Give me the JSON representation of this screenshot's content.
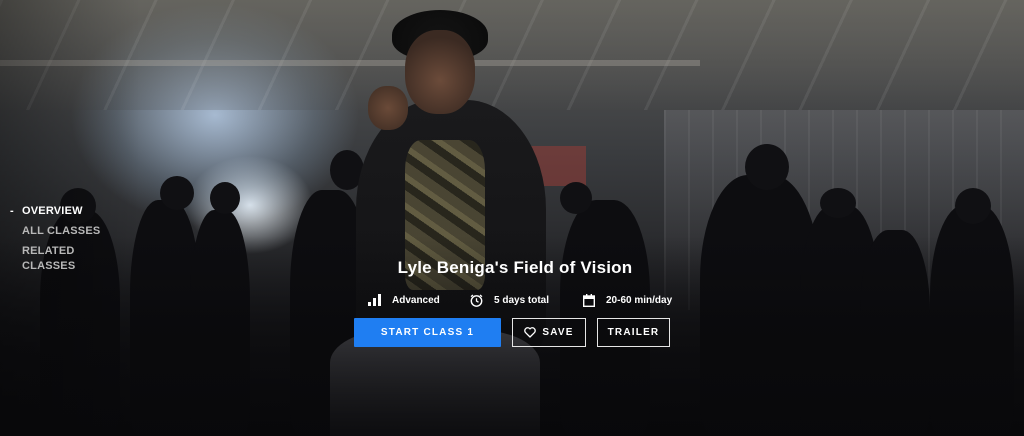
{
  "sidebar": {
    "items": [
      {
        "label": "OVERVIEW",
        "active": true
      },
      {
        "label": "ALL CLASSES",
        "active": false
      },
      {
        "label": "RELATED CLASSES",
        "active": false
      }
    ]
  },
  "hero": {
    "title": "Lyle Beniga's Field of Vision",
    "meta": {
      "level": {
        "icon": "signal-bars-icon",
        "text": "Advanced"
      },
      "duration": {
        "icon": "clock-icon",
        "text": "5 days total"
      },
      "schedule": {
        "icon": "calendar-icon",
        "text": "20-60 min/day"
      }
    },
    "buttons": {
      "start": "START CLASS 1",
      "save": "SAVE",
      "trailer": "TRAILER"
    }
  },
  "colors": {
    "accent": "#1f7ef2",
    "text": "#ffffff",
    "nav_inactive": "#b8b8b8"
  }
}
